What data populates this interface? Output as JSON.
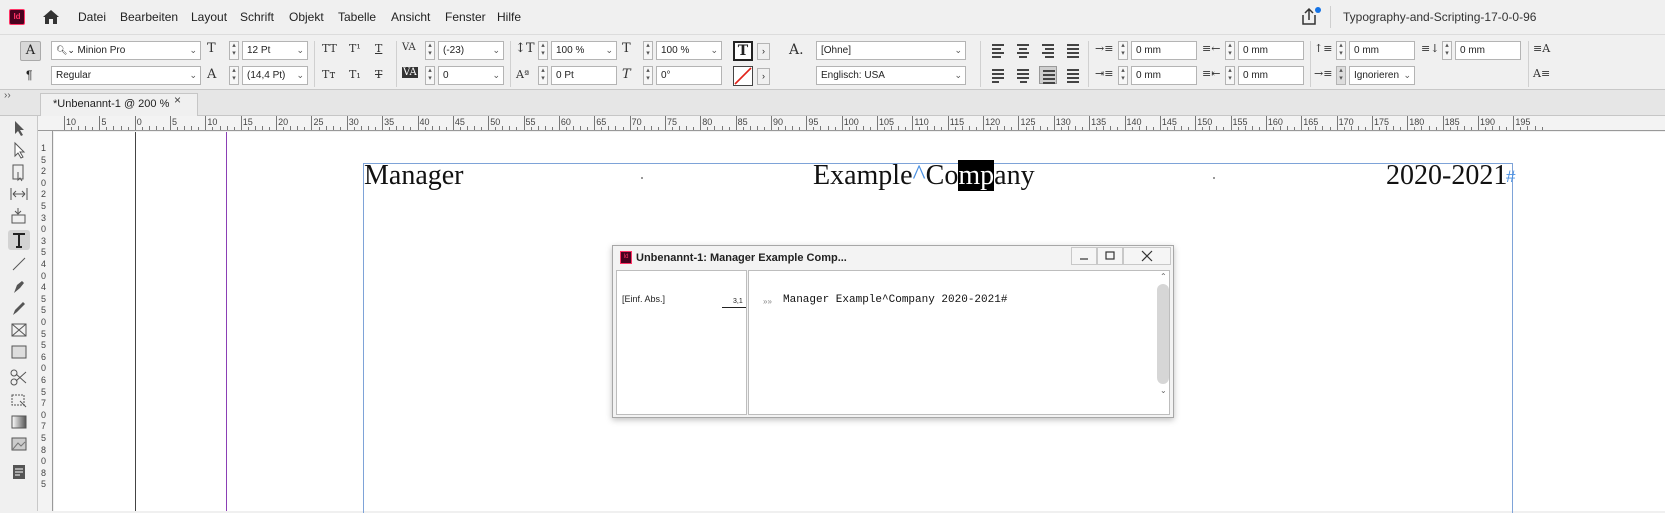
{
  "app": {
    "logo_text": "Id",
    "document_title": "Typography-and-Scripting-17-0-0-96"
  },
  "menu": [
    "Datei",
    "Bearbeiten",
    "Layout",
    "Schrift",
    "Objekt",
    "Tabelle",
    "Ansicht",
    "Fenster",
    "Hilfe"
  ],
  "control": {
    "font_family": "Minion Pro",
    "font_style": "Regular",
    "font_size": "12 Pt",
    "leading": "(14,4 Pt)",
    "kerning": "(-23)",
    "tracking": "0",
    "vertical_scale": "100 %",
    "horizontal_scale": "100 %",
    "baseline_shift": "0 Pt",
    "skew": "0°",
    "char_style": "[Ohne]",
    "language": "Englisch: USA",
    "left_indent": "0 mm",
    "right_indent": "0 mm",
    "first_line_indent": "0 mm",
    "last_line_indent": "0 mm",
    "space_before": "0 mm",
    "space_after": "0 mm",
    "grid_align": "Ignorieren"
  },
  "tab": {
    "label": "*Unbenannt-1 @ 200 %",
    "close": "×"
  },
  "ruler_labels": [
    "10",
    "5",
    "0",
    "5",
    "10",
    "15",
    "20",
    "25",
    "30",
    "35",
    "40",
    "45",
    "50",
    "55",
    "60",
    "65",
    "70",
    "75",
    "80",
    "85",
    "90",
    "95",
    "100",
    "105",
    "110",
    "115",
    "120",
    "125",
    "130",
    "135",
    "140",
    "145",
    "150",
    "155",
    "160",
    "165",
    "170",
    "175",
    "180",
    "185",
    "190",
    "195"
  ],
  "ruler_v_labels": [
    "1",
    "5",
    "2",
    "0",
    "2",
    "5",
    "3",
    "0",
    "3",
    "5",
    "4",
    "0",
    "4",
    "5",
    "5",
    "0",
    "5",
    "5",
    "6",
    "0",
    "6",
    "5",
    "7",
    "0",
    "7",
    "5",
    "8",
    "0",
    "8",
    "5"
  ],
  "document": {
    "left_text": "Manager",
    "mid_text_a": "Example",
    "mid_caret": "^",
    "mid_text_b": "Co",
    "mid_selected": "mp",
    "mid_text_c": "any",
    "right_text": "2020-2021",
    "end_mark": "#"
  },
  "story_editor": {
    "title": "Unbenannt-1: Manager Example Comp...",
    "paragraph_style": "[Einf. Abs.]",
    "depth": "3,1",
    "text": "Manager Example^Company 2020-2021#",
    "marker": "»»"
  }
}
